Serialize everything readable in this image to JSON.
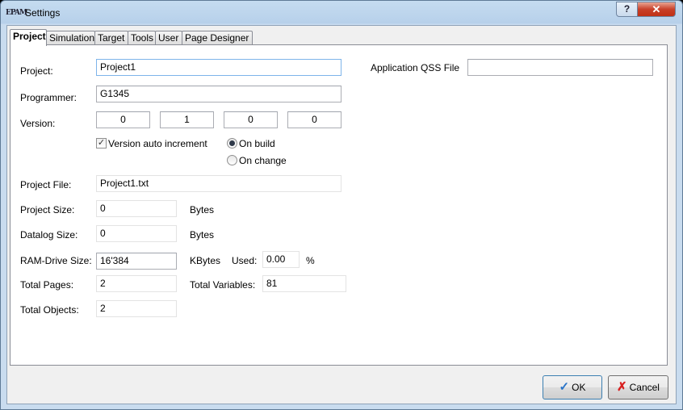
{
  "window": {
    "title": "Settings",
    "app_icon": "EPAM"
  },
  "titlebar": {
    "help_label": "?",
    "close_label": "✕"
  },
  "tabs": [
    "Project",
    "Simulation",
    "Target",
    "Tools",
    "User",
    "Page Designer"
  ],
  "project": {
    "project_label": "Project:",
    "project_value": "Project1",
    "programmer_label": "Programmer:",
    "programmer_value": "G1345",
    "version_label": "Version:",
    "version": [
      "0",
      "1",
      "0",
      "0"
    ],
    "auto_increment_label": "Version auto increment",
    "auto_increment_checked": true,
    "on_build_label": "On build",
    "on_change_label": "On change",
    "project_file_label": "Project File:",
    "project_file_value": "Project1.txt",
    "project_size_label": "Project Size:",
    "project_size_value": "0",
    "project_size_unit": "Bytes",
    "datalog_size_label": "Datalog Size:",
    "datalog_size_value": "0",
    "datalog_size_unit": "Bytes",
    "ram_drive_label": "RAM-Drive Size:",
    "ram_drive_value": "16'384",
    "ram_drive_unit": "KBytes",
    "used_label": "Used:",
    "used_value": "0.00",
    "used_unit": "%",
    "total_pages_label": "Total Pages:",
    "total_pages_value": "2",
    "total_variables_label": "Total Variables:",
    "total_variables_value": "81",
    "total_objects_label": "Total Objects:",
    "total_objects_value": "2",
    "qss_label": "Application QSS File",
    "qss_value": ""
  },
  "buttons": {
    "ok_label": "OK",
    "cancel_label": "Cancel"
  },
  "colors": {
    "accent": "#7eb4ea",
    "close": "#c8412a",
    "ok_icon": "#2a74c8",
    "cancel_icon": "#d82020"
  }
}
